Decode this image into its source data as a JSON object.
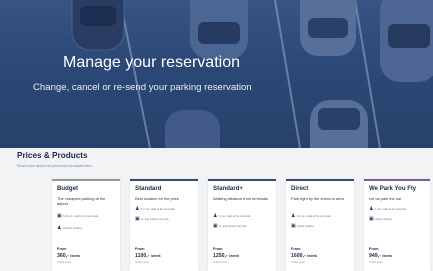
{
  "hero": {
    "title": "Manage your reservation",
    "subtitle": "Change, cancel or re-send your parking reservation"
  },
  "prices": {
    "title": "Prices & Products",
    "subtitle": "Read more about our prices and products here."
  },
  "cards": [
    {
      "title": "Budget",
      "accent": "#9a9a9a",
      "desc": "The cheapest parking at the airport",
      "features": [
        {
          "icon": "bus-icon",
          "glyph": "▣",
          "text": "5-15 min. walk to the terminals"
        },
        {
          "icon": "walk-icon",
          "glyph": "♟",
          "text": "Outdoor parking"
        }
      ],
      "from_label": "From",
      "price": "360,-",
      "per": "/week",
      "note": "Online price"
    },
    {
      "title": "Standard",
      "accent": "#36496f",
      "desc": "Best location for the price",
      "features": [
        {
          "icon": "walk-icon",
          "glyph": "♟",
          "text": "5-7 min. walk to the terminals"
        },
        {
          "icon": "car-icon",
          "glyph": "▣",
          "text": "In- and outdoor car park"
        }
      ],
      "from_label": "From",
      "price": "1100,-",
      "per": "/week",
      "note": "Online price"
    },
    {
      "title": "Standard+",
      "accent": "#36496f",
      "desc": "Walking distance from terminals",
      "features": [
        {
          "icon": "walk-icon",
          "glyph": "♟",
          "text": "3 min. walk to the terminals"
        },
        {
          "icon": "car-icon",
          "glyph": "▣",
          "text": "In- and outdoor car park"
        }
      ],
      "from_label": "From",
      "price": "1250,-",
      "per": "/week",
      "note": "Online price"
    },
    {
      "title": "Direct",
      "accent": "#36496f",
      "desc": "Park right by the check-in area",
      "features": [
        {
          "icon": "walk-icon",
          "glyph": "♟",
          "text": "0-1 min. walk to the terminals"
        },
        {
          "icon": "car-icon",
          "glyph": "▣",
          "text": "Indoor parking"
        }
      ],
      "from_label": "From",
      "price": "1600,-",
      "per": "/week",
      "note": "Online price"
    },
    {
      "title": "We Park You Fly",
      "accent": "#7a5aa6",
      "desc": "Let us park the car",
      "features": [
        {
          "icon": "walk-icon",
          "glyph": "♟",
          "text": "1 min. walk to the terminals"
        },
        {
          "icon": "car-icon",
          "glyph": "▣",
          "text": "Indoor parking"
        }
      ],
      "from_label": "From",
      "price": "949,-",
      "per": "/week",
      "note": "Online price"
    }
  ]
}
